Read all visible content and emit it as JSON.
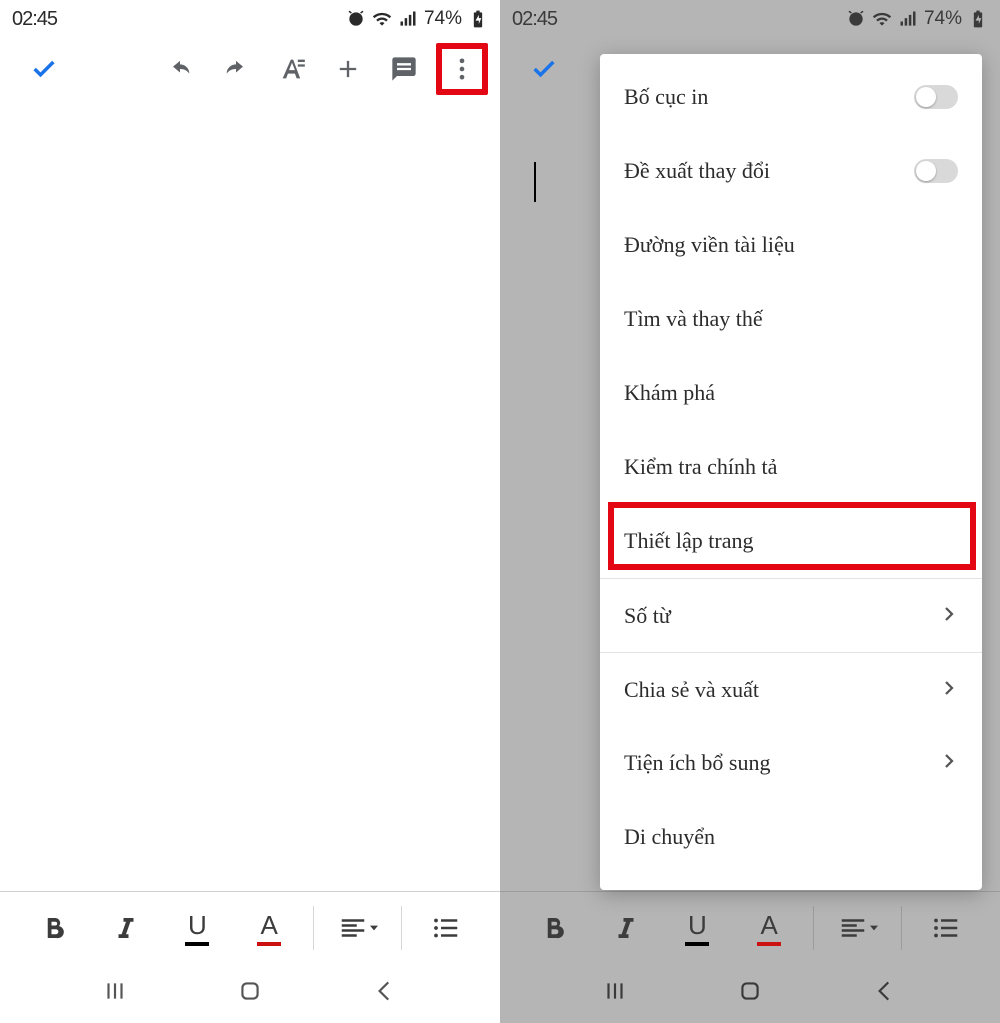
{
  "status": {
    "time": "02:45",
    "battery": "74%"
  },
  "menu": {
    "items": [
      {
        "label": "Bố cục in",
        "type": "toggle"
      },
      {
        "label": "Đề xuất thay đổi",
        "type": "toggle"
      },
      {
        "label": "Đường viền tài liệu",
        "type": "plain"
      },
      {
        "label": "Tìm và thay thế",
        "type": "plain"
      },
      {
        "label": "Khám phá",
        "type": "plain"
      },
      {
        "label": "Kiểm tra chính tả",
        "type": "plain"
      },
      {
        "label": "Thiết lập trang",
        "type": "plain",
        "highlighted": true
      },
      {
        "label": "Số từ",
        "type": "chevron",
        "sep": true
      },
      {
        "label": "Chia sẻ và xuất",
        "type": "chevron",
        "sep": true
      },
      {
        "label": "Tiện ích bổ sung",
        "type": "chevron"
      },
      {
        "label": "Di chuyển",
        "type": "plain"
      }
    ]
  }
}
